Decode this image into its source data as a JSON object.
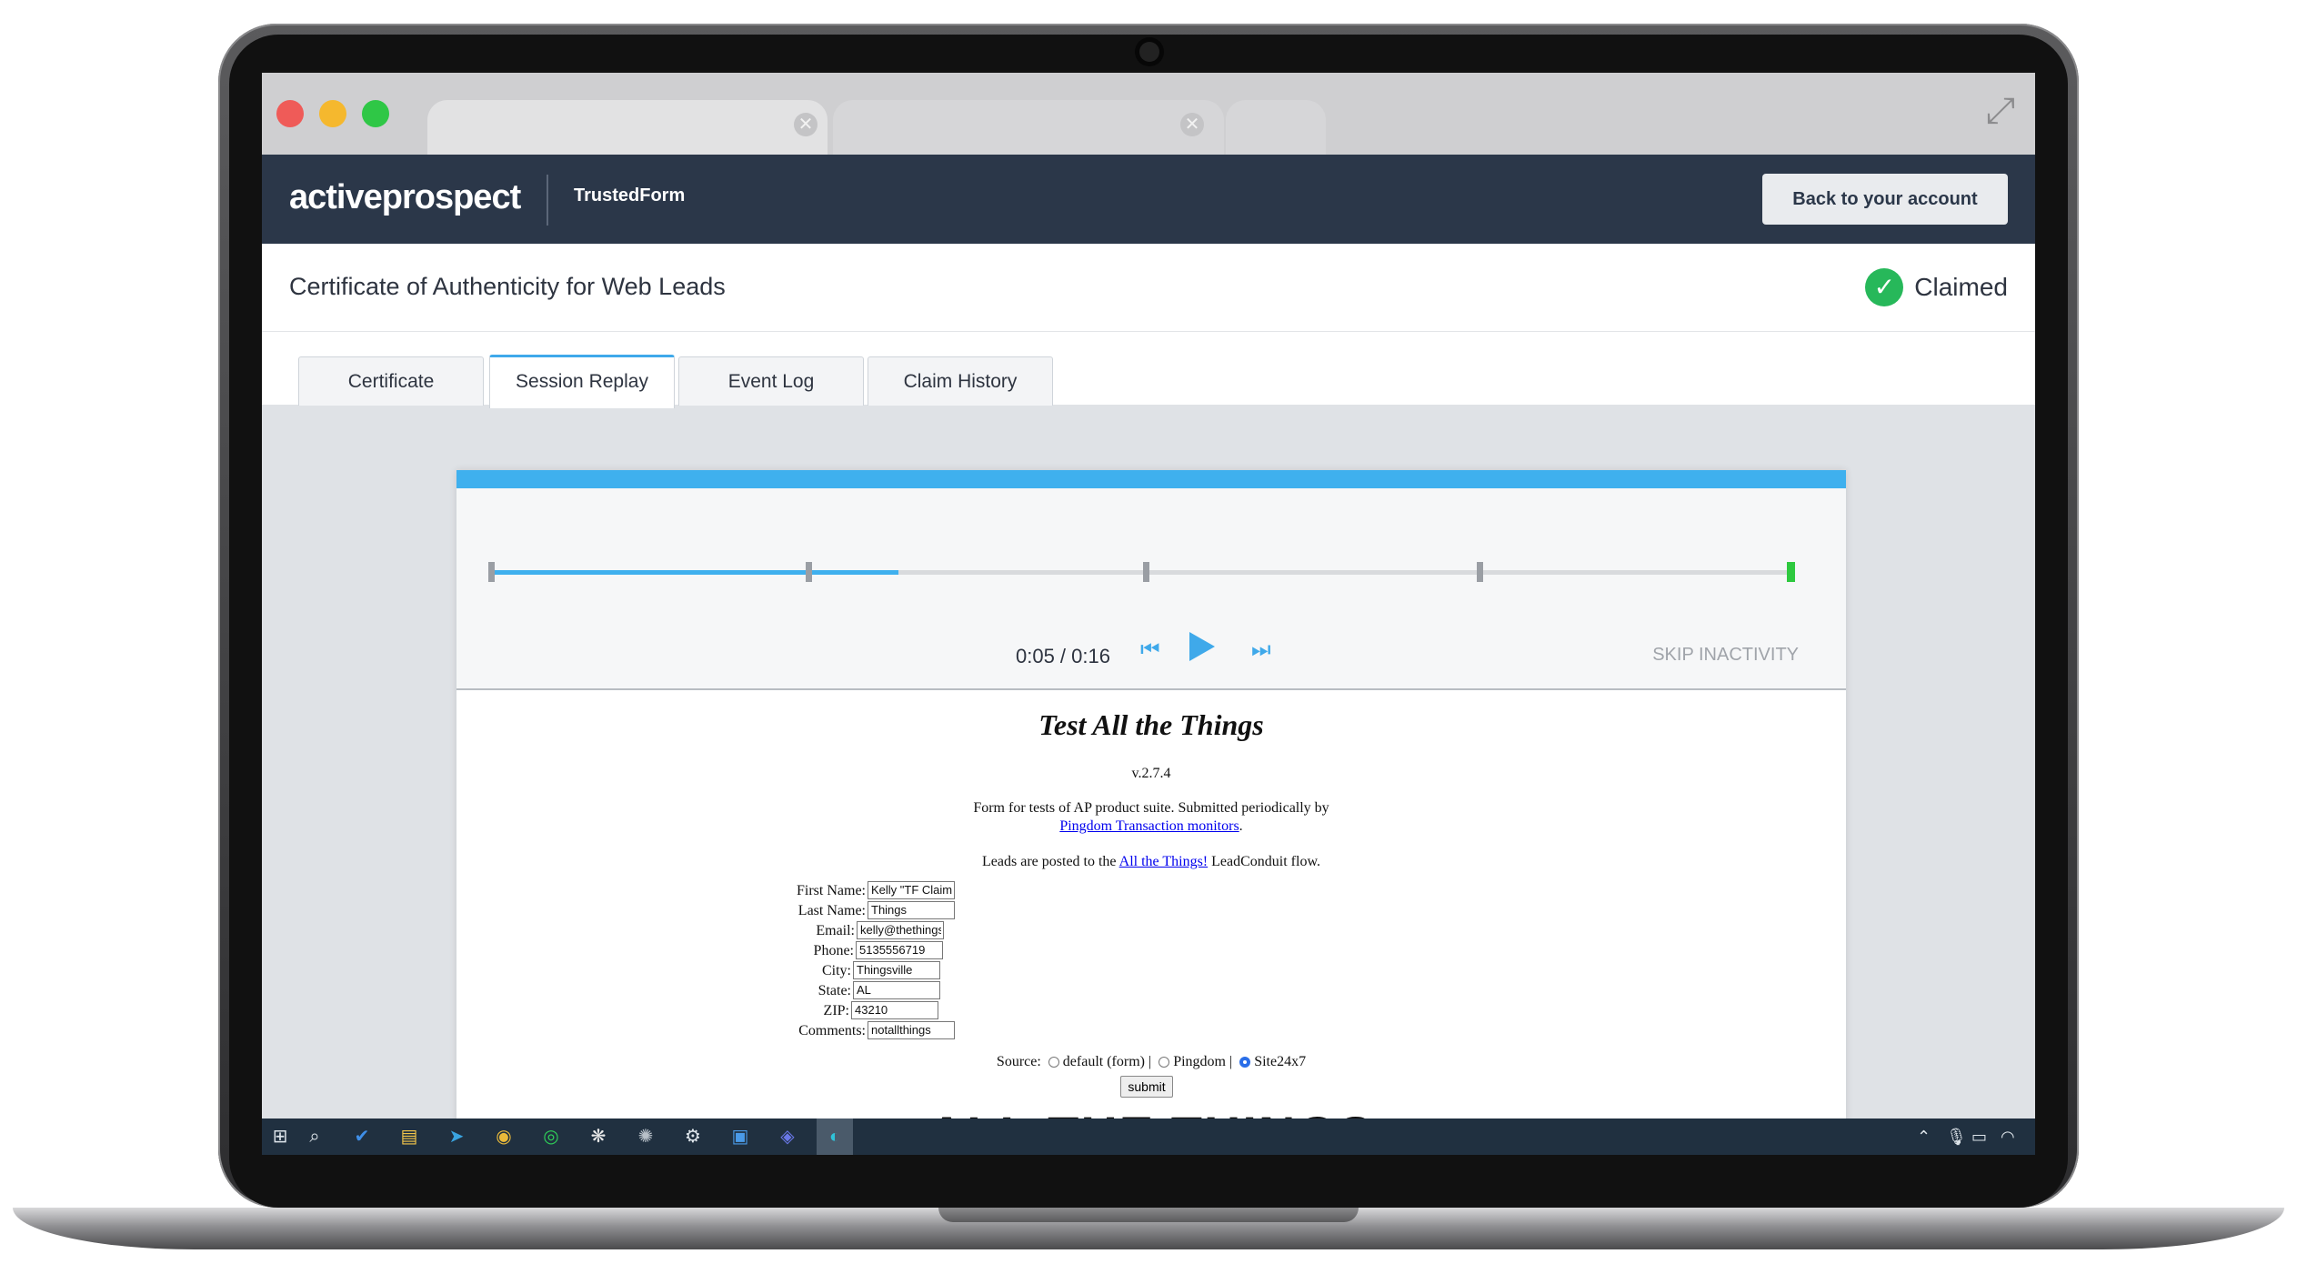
{
  "browser": {
    "close_glyph": "✕",
    "expand_glyph": "⤢"
  },
  "header": {
    "logo": "activeprospect",
    "product": "TrustedForm",
    "back_button": "Back to your account"
  },
  "titlebar": {
    "title": "Certificate of Authenticity for Web Leads",
    "status": "Claimed",
    "status_icon": "check-circle-icon",
    "status_color": "#27b85a"
  },
  "tabs": [
    {
      "label": "Certificate",
      "active": false
    },
    {
      "label": "Session Replay",
      "active": true
    },
    {
      "label": "Event Log",
      "active": false
    },
    {
      "label": "Claim History",
      "active": false
    }
  ],
  "player": {
    "accent_color": "#3fb0ee",
    "time": "0:05 / 0:16",
    "progress_fraction": 0.3125,
    "skip_label": "SKIP INACTIVITY"
  },
  "form": {
    "title": "Test All the Things",
    "version": "v.2.7.4",
    "desc_line1": "Form for tests of AP product suite. Submitted periodically by",
    "desc_link": "Pingdom Transaction monitors",
    "desc_end": ".",
    "leads_pre": "Leads are posted to the",
    "leads_link": "All the Things!",
    "leads_post": "LeadConduit flow.",
    "fields": [
      {
        "label": "First Name:",
        "value": "Kelly \"TF Claim\""
      },
      {
        "label": "Last Name:",
        "value": "Things"
      },
      {
        "label": "Email:",
        "value": "kelly@thethings.biz"
      },
      {
        "label": "Phone:",
        "value": "5135556719"
      },
      {
        "label": "City:",
        "value": "Thingsville"
      },
      {
        "label": "State:",
        "value": "AL"
      },
      {
        "label": "ZIP:",
        "value": "43210"
      },
      {
        "label": "Comments:",
        "value": "notallthings"
      }
    ],
    "source_label": "Source:",
    "source_options": [
      "default (form) |",
      "Pingdom |",
      "Site24x7"
    ],
    "source_selected": "Site24x7",
    "submit": "submit",
    "big_heading": "ALL THE THINGS"
  },
  "taskbar": {
    "icons": [
      "windows-icon",
      "search-icon",
      "todo-icon",
      "file-explorer-icon",
      "telegram-icon",
      "chrome-icon",
      "spotify-icon",
      "app-icon",
      "app-icon-2",
      "settings-icon",
      "photos-icon",
      "teams-icon",
      "edge-icon"
    ]
  }
}
